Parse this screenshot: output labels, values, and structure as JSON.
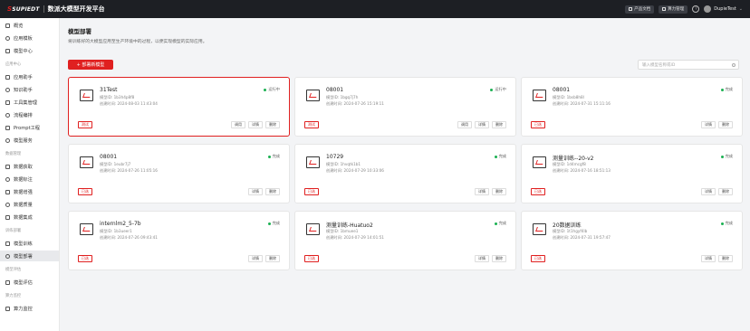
{
  "topbar": {
    "brand": "SUPIEDT",
    "title": "数派大模型开发平台",
    "btn_docs": "产品文档",
    "btn_compute": "算力管理",
    "help": "?",
    "user": "DupieTest"
  },
  "sidebar": {
    "items_top": [
      {
        "label": "概览",
        "icon": "home-icon"
      },
      {
        "label": "应用模板",
        "icon": "template-icon"
      },
      {
        "label": "模型中心",
        "icon": "model-center-icon"
      }
    ],
    "sec_app": "应用中心",
    "items_app": [
      {
        "label": "应用助手",
        "icon": "app-icon"
      },
      {
        "label": "知识助手",
        "icon": "knowledge-icon"
      },
      {
        "label": "工具集管理",
        "icon": "tools-icon"
      },
      {
        "label": "流程编排",
        "icon": "flow-icon"
      },
      {
        "label": "Prompt工程",
        "icon": "prompt-icon"
      },
      {
        "label": "模型服务",
        "icon": "service-icon"
      }
    ],
    "sec_data": "数据管理",
    "items_data": [
      {
        "label": "数据获取",
        "icon": "data-acquire-icon"
      },
      {
        "label": "数据标注",
        "icon": "data-label-icon"
      },
      {
        "label": "数据增强",
        "icon": "data-enhance-icon"
      },
      {
        "label": "数据质量",
        "icon": "data-quality-icon"
      },
      {
        "label": "数据集成",
        "icon": "data-integrate-icon"
      }
    ],
    "sec_train": "训练部署",
    "items_train": [
      {
        "label": "模型训练",
        "icon": "train-icon"
      },
      {
        "label": "模型部署",
        "icon": "deploy-icon"
      }
    ],
    "sec_eval": "模型评估",
    "items_eval": [
      {
        "label": "模型评估",
        "icon": "eval-icon"
      }
    ],
    "sec_compute": "算力监控",
    "items_compute": [
      {
        "label": "算力监控",
        "icon": "monitor-icon"
      }
    ]
  },
  "page": {
    "title": "模型部署",
    "desc": "将训练好的大模型应用至生产环境中的过程，以便实现模型的实际应用。",
    "create_btn": "+ 部署新模型",
    "search_placeholder": "输入模型名称或ID"
  },
  "cards": [
    {
      "name": "31Test",
      "id": "模型ID: 1b3h4p8f8",
      "time": "创建时间: 2024-08-03 11:43:04",
      "status": "运行中",
      "tag": "测试",
      "actions": [
        "调用",
        "详情",
        "删除"
      ]
    },
    {
      "name": "08001",
      "id": "模型ID: 1bgq7j7h",
      "time": "创建时间: 2024-07-26 15:19:11",
      "status": "运行中",
      "tag": "测试",
      "actions": [
        "调用",
        "详情",
        "删除"
      ]
    },
    {
      "name": "08001",
      "id": "模型ID: 1bsb8h8l",
      "time": "创建时间: 2024-07-31 15:11:16",
      "status": "完成",
      "tag": "已选",
      "actions": [
        "详情",
        "删除"
      ]
    },
    {
      "name": "08001",
      "id": "模型ID: 1eubr7j7",
      "time": "创建时间: 2024-07-26 11:05:16",
      "status": "完成",
      "tag": "已选",
      "actions": [
        "详情",
        "删除"
      ]
    },
    {
      "name": "10729",
      "id": "模型ID: 1hvqtk1b1",
      "time": "创建时间: 2024-07-29 10:33:06",
      "status": "完成",
      "tag": "已选",
      "actions": [
        "详情",
        "删除"
      ]
    },
    {
      "name": "测量训练--20-v2",
      "id": "模型ID: 1d4mcgf8",
      "time": "创建时间: 2024-07-16 18:51:13",
      "status": "完成",
      "tag": "已选",
      "actions": [
        "详情",
        "删除"
      ]
    },
    {
      "name": "internlm2_5-7b",
      "id": "模型ID: 1b3ueer1",
      "time": "创建时间: 2024-07-26 09:43:41",
      "status": "完成",
      "tag": "已选",
      "actions": [
        "详情",
        "删除"
      ]
    },
    {
      "name": "测量训练-Huatuo2",
      "id": "模型ID: 1bmuee1",
      "time": "创建时间: 2024-07-29 14:01:51",
      "status": "完成",
      "tag": "已选",
      "actions": [
        "详情",
        "删除"
      ]
    },
    {
      "name": "20数据训练",
      "id": "模型ID: 1t1hgyf4lb",
      "time": "创建时间: 2024-07-31 19:57:47",
      "status": "完成",
      "tag": "已选",
      "actions": [
        "详情",
        "删除"
      ]
    }
  ]
}
